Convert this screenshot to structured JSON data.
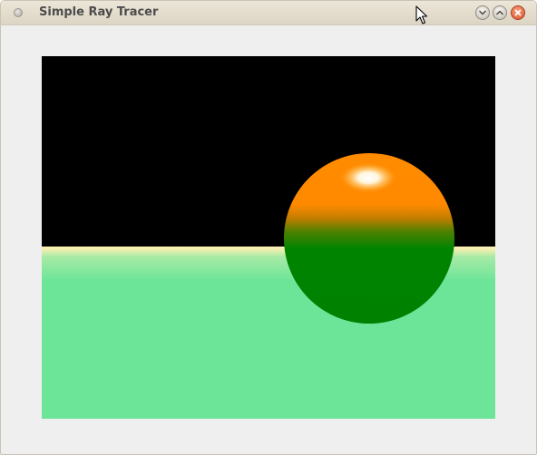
{
  "window": {
    "title": "Simple Ray Tracer",
    "controls": {
      "minimize_icon": "chevron-down-icon",
      "maximize_icon": "chevron-up-icon",
      "close_icon": "close-icon"
    }
  },
  "scene": {
    "colors": {
      "sky": "#000000",
      "floor": "#6ce599",
      "horizon_highlight": "#fff3b8",
      "sphere_top": "#ff8b00",
      "sphere_bottom": "#008400",
      "specular": "#ffffff"
    }
  }
}
